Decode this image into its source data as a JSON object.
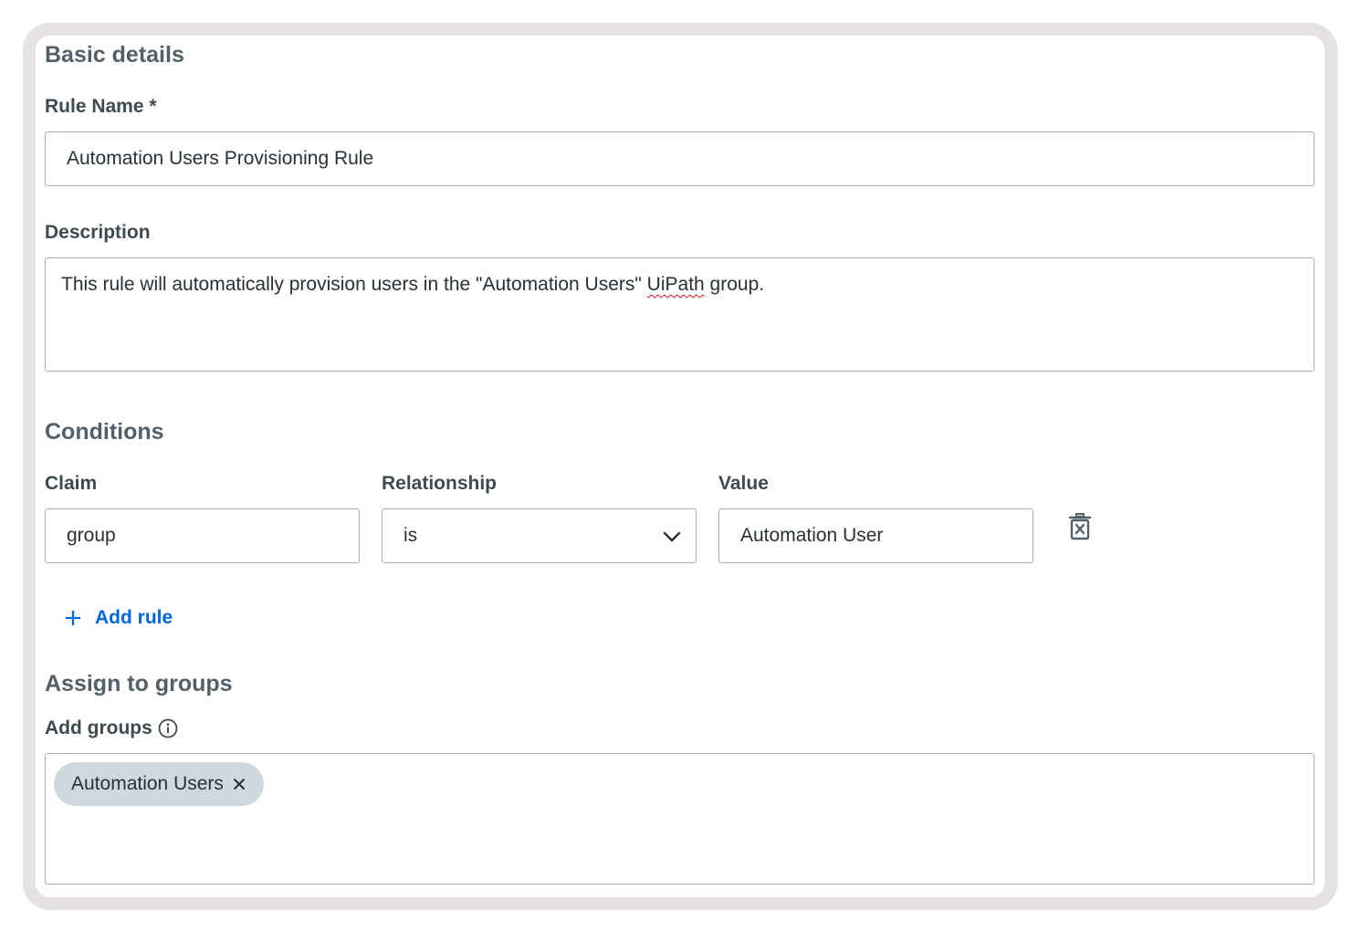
{
  "basic_details": {
    "title": "Basic details",
    "rule_name_label": "Rule Name *",
    "rule_name_value": "Automation Users Provisioning Rule",
    "description_label": "Description",
    "description_before": "This rule will automatically provision users in the \"Automation Users\" ",
    "description_misspelled": "UiPath",
    "description_after": " group."
  },
  "conditions": {
    "title": "Conditions",
    "claim_label": "Claim",
    "relationship_label": "Relationship",
    "value_label": "Value",
    "rows": [
      {
        "claim": "group",
        "relationship": "is",
        "value": "Automation User"
      }
    ],
    "add_rule_label": "Add rule",
    "delete_icon": "trash-x-icon"
  },
  "assign": {
    "title": "Assign to groups",
    "add_groups_label": "Add groups",
    "info_icon": "info-icon",
    "chips": [
      {
        "label": "Automation Users"
      }
    ]
  },
  "colors": {
    "accent": "#0067df",
    "heading": "#536069",
    "label": "#3d4a52",
    "text": "#273139",
    "border": "#a4b1b8",
    "chip_bg": "#cfd8dd",
    "frame": "#e6e2e2"
  }
}
